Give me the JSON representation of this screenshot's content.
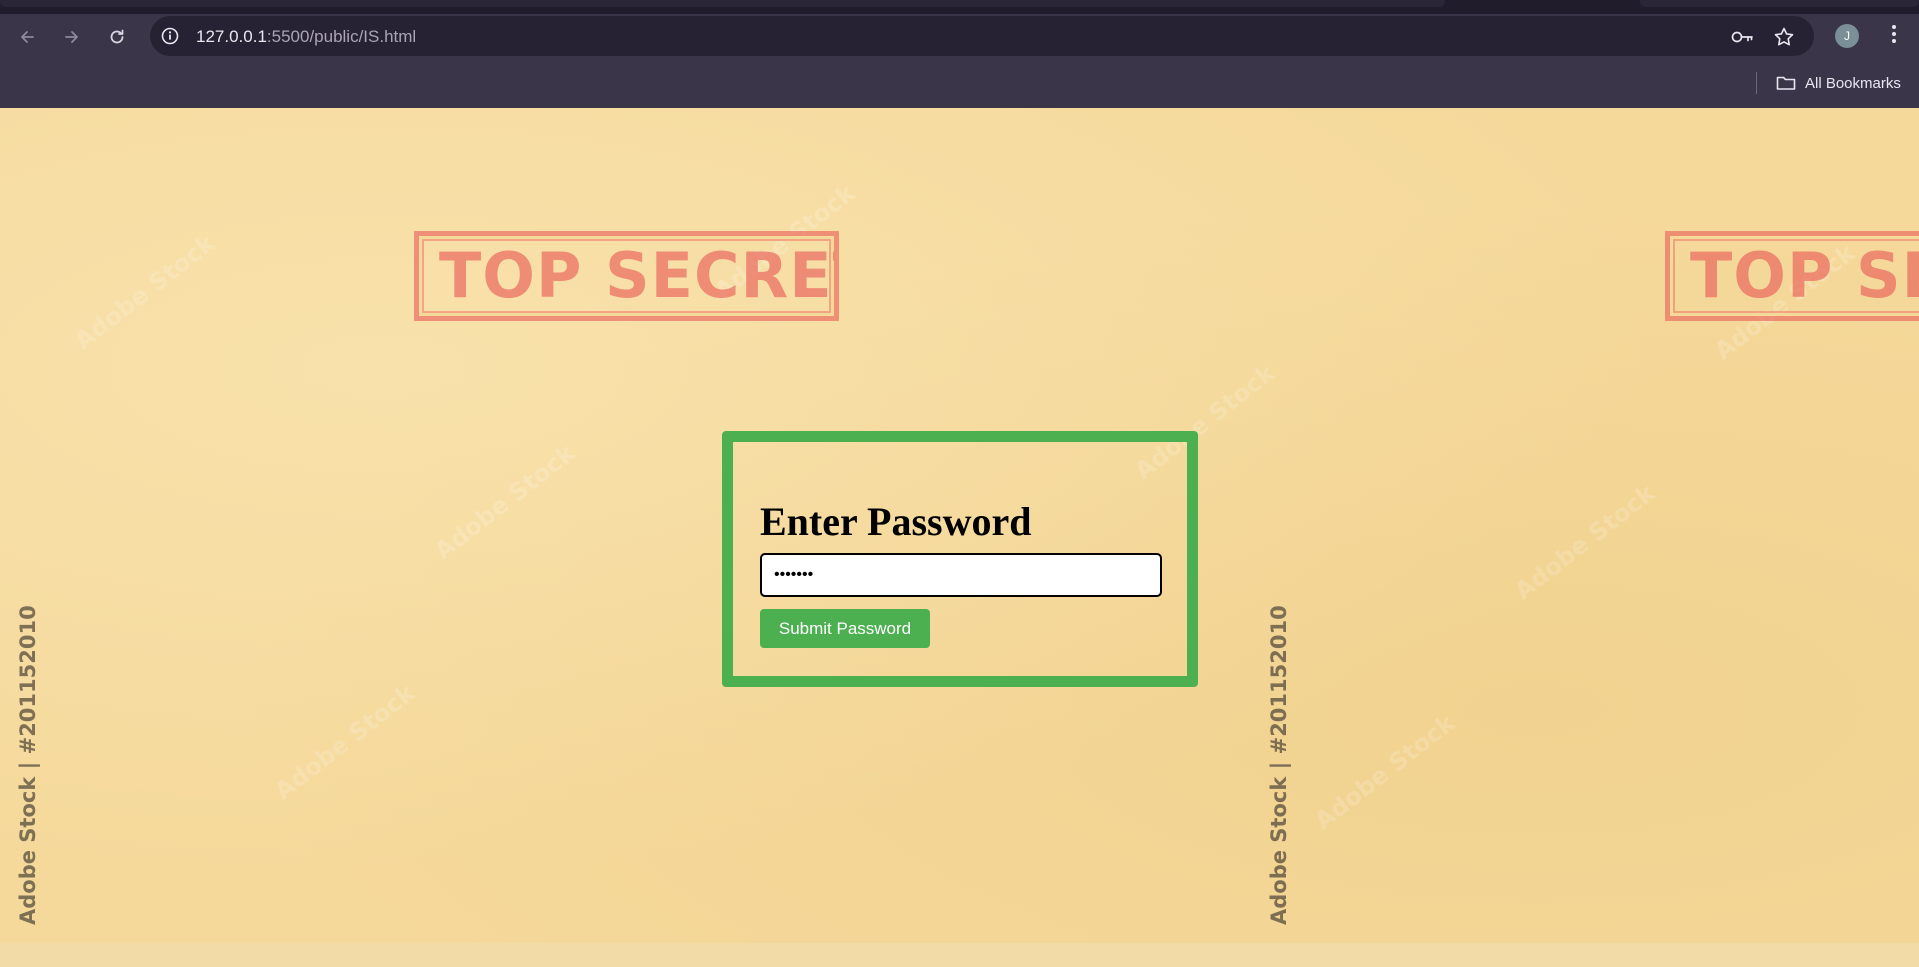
{
  "browser": {
    "url_host": "127.0.0.1",
    "url_rest": ":5500/public/IS.html",
    "profile_initial": "J",
    "bookmarks_label": "All Bookmarks"
  },
  "page": {
    "stamp_text": "TOP SECRET",
    "stamp_text_partial": "TOP SEC",
    "watermark_text": "Adobe Stock | #201152010",
    "faint_watermark": "Adobe Stock",
    "heading": "Enter Password",
    "password_value": "•••••••",
    "submit_label": "Submit Password"
  },
  "colors": {
    "accent_green": "#4caf50",
    "stamp_red": "#e85855",
    "paper": "#f5d99b",
    "chrome": "#3b354a"
  }
}
